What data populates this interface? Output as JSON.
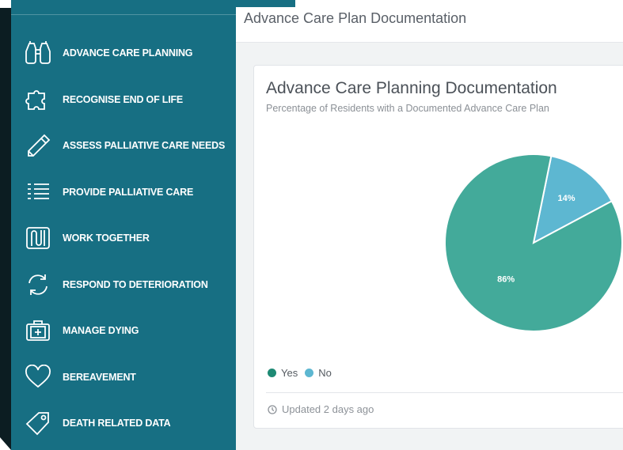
{
  "sidebar": {
    "items": [
      {
        "label": "ADVANCE CARE PLANNING",
        "icon": "binoculars-icon"
      },
      {
        "label": "RECOGNISE END OF LIFE",
        "icon": "puzzle-icon"
      },
      {
        "label": "ASSESS PALLIATIVE CARE NEEDS",
        "icon": "pencil-icon"
      },
      {
        "label": "PROVIDE PALLIATIVE CARE",
        "icon": "list-icon"
      },
      {
        "label": "WORK TOGETHER",
        "icon": "linked-lines-icon"
      },
      {
        "label": "RESPOND TO DETERIORATION",
        "icon": "refresh-icon"
      },
      {
        "label": "MANAGE DYING",
        "icon": "medical-kit-icon"
      },
      {
        "label": "BEREAVEMENT",
        "icon": "heart-icon"
      },
      {
        "label": "DEATH RELATED DATA",
        "icon": "tag-icon"
      }
    ]
  },
  "header": {
    "title": "Advance Care Plan Documentation"
  },
  "card": {
    "title": "Advance Care Planning Documentation",
    "subtitle": "Percentage of Residents with a Documented Advance Care Plan",
    "footer": "Updated 2 days ago"
  },
  "chart_data": {
    "type": "pie",
    "categories": [
      "Yes",
      "No"
    ],
    "values": [
      86,
      14
    ],
    "labels": [
      "86%",
      "14%"
    ],
    "colors": [
      "#43aa9a",
      "#5db7d1"
    ],
    "legend_colors": [
      "#1e8a74",
      "#5db7d1"
    ],
    "legend_position": "bottom-left"
  },
  "colors": {
    "sidebar_bg": "#176f83",
    "accent": "#43aa9a"
  }
}
